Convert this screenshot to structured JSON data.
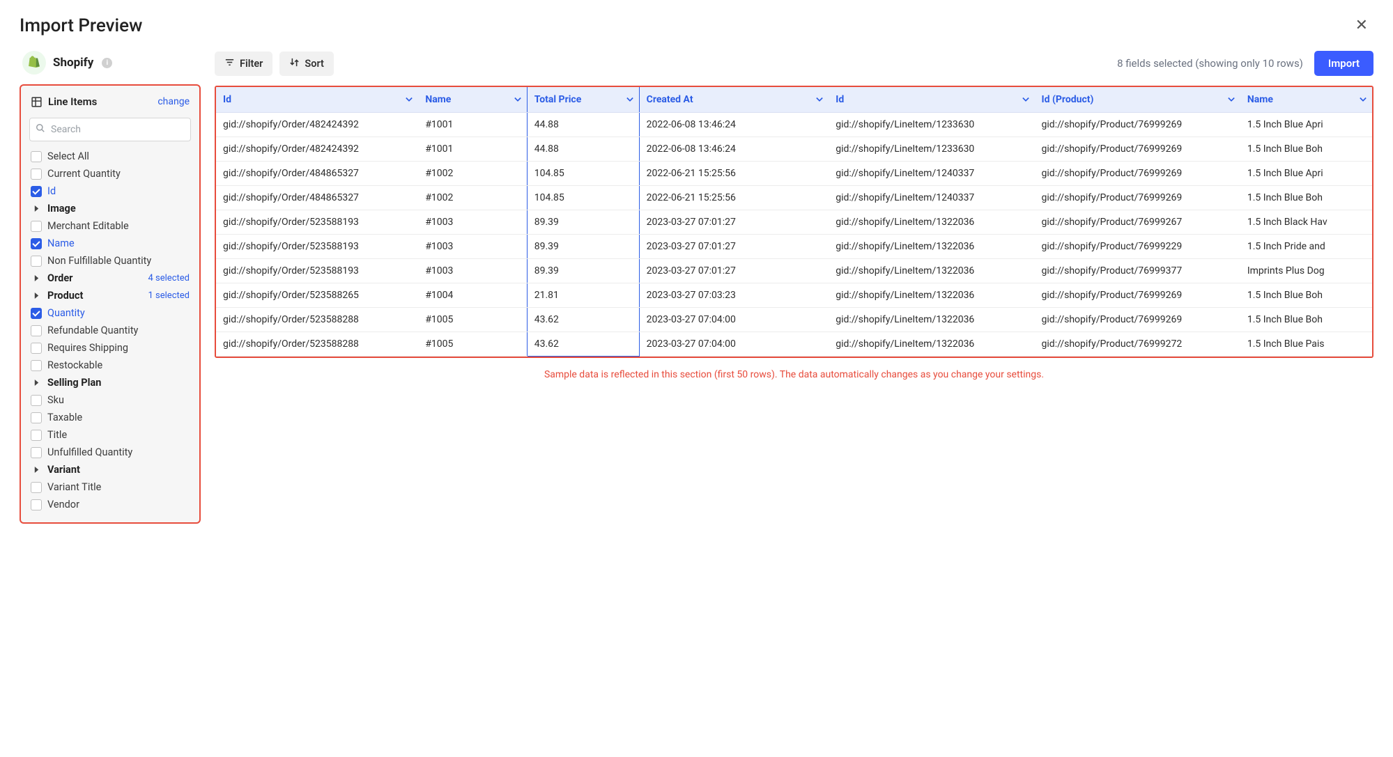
{
  "header": {
    "title": "Import Preview"
  },
  "integration": {
    "name": "Shopify"
  },
  "sidebar": {
    "section_title": "Line Items",
    "change_label": "change",
    "search_placeholder": "Search",
    "fields": [
      {
        "label": "Select All",
        "type": "check",
        "checked": false
      },
      {
        "label": "Current Quantity",
        "type": "check",
        "checked": false
      },
      {
        "label": "Id",
        "type": "check",
        "checked": true
      },
      {
        "label": "Image",
        "type": "expand",
        "bold": true
      },
      {
        "label": "Merchant Editable",
        "type": "check",
        "checked": false
      },
      {
        "label": "Name",
        "type": "check",
        "checked": true
      },
      {
        "label": "Non Fulfillable Quantity",
        "type": "check",
        "checked": false
      },
      {
        "label": "Order",
        "type": "expand",
        "bold": true,
        "badge": "4 selected"
      },
      {
        "label": "Product",
        "type": "expand",
        "bold": true,
        "badge": "1 selected"
      },
      {
        "label": "Quantity",
        "type": "check",
        "checked": true
      },
      {
        "label": "Refundable Quantity",
        "type": "check",
        "checked": false
      },
      {
        "label": "Requires Shipping",
        "type": "check",
        "checked": false
      },
      {
        "label": "Restockable",
        "type": "check",
        "checked": false
      },
      {
        "label": "Selling Plan",
        "type": "expand",
        "bold": true
      },
      {
        "label": "Sku",
        "type": "check",
        "checked": false
      },
      {
        "label": "Taxable",
        "type": "check",
        "checked": false
      },
      {
        "label": "Title",
        "type": "check",
        "checked": false
      },
      {
        "label": "Unfulfilled Quantity",
        "type": "check",
        "checked": false
      },
      {
        "label": "Variant",
        "type": "expand",
        "bold": true
      },
      {
        "label": "Variant Title",
        "type": "check",
        "checked": false
      },
      {
        "label": "Vendor",
        "type": "check",
        "checked": false
      }
    ]
  },
  "toolbar": {
    "filter_label": "Filter",
    "sort_label": "Sort",
    "status_text": "8 fields selected (showing only 10 rows)",
    "import_label": "Import"
  },
  "table": {
    "columns": [
      "Id",
      "Name",
      "Total Price",
      "Created At",
      "Id",
      "Id (Product)",
      "Name"
    ],
    "highlight_col_index": 2,
    "rows": [
      [
        "gid://shopify/Order/482424392",
        "#1001",
        "44.88",
        "2022-06-08 13:46:24",
        "gid://shopify/LineItem/1233630",
        "gid://shopify/Product/76999269",
        "1.5 Inch Blue Apri"
      ],
      [
        "gid://shopify/Order/482424392",
        "#1001",
        "44.88",
        "2022-06-08 13:46:24",
        "gid://shopify/LineItem/1233630",
        "gid://shopify/Product/76999269",
        "1.5 Inch Blue Boh"
      ],
      [
        "gid://shopify/Order/484865327",
        "#1002",
        "104.85",
        "2022-06-21 15:25:56",
        "gid://shopify/LineItem/1240337",
        "gid://shopify/Product/76999269",
        "1.5 Inch Blue Apri"
      ],
      [
        "gid://shopify/Order/484865327",
        "#1002",
        "104.85",
        "2022-06-21 15:25:56",
        "gid://shopify/LineItem/1240337",
        "gid://shopify/Product/76999269",
        "1.5 Inch Blue Boh"
      ],
      [
        "gid://shopify/Order/523588193",
        "#1003",
        "89.39",
        "2023-03-27 07:01:27",
        "gid://shopify/LineItem/1322036",
        "gid://shopify/Product/76999267",
        "1.5 Inch Black Hav"
      ],
      [
        "gid://shopify/Order/523588193",
        "#1003",
        "89.39",
        "2023-03-27 07:01:27",
        "gid://shopify/LineItem/1322036",
        "gid://shopify/Product/76999229",
        "1.5 Inch Pride and"
      ],
      [
        "gid://shopify/Order/523588193",
        "#1003",
        "89.39",
        "2023-03-27 07:01:27",
        "gid://shopify/LineItem/1322036",
        "gid://shopify/Product/76999377",
        "Imprints Plus Dog"
      ],
      [
        "gid://shopify/Order/523588265",
        "#1004",
        "21.81",
        "2023-03-27 07:03:23",
        "gid://shopify/LineItem/1322036",
        "gid://shopify/Product/76999269",
        "1.5 Inch Blue Boh"
      ],
      [
        "gid://shopify/Order/523588288",
        "#1005",
        "43.62",
        "2023-03-27 07:04:00",
        "gid://shopify/LineItem/1322036",
        "gid://shopify/Product/76999269",
        "1.5 Inch Blue Boh"
      ],
      [
        "gid://shopify/Order/523588288",
        "#1005",
        "43.62",
        "2023-03-27 07:04:00",
        "gid://shopify/LineItem/1322036",
        "gid://shopify/Product/76999272",
        "1.5 Inch Blue Pais"
      ]
    ]
  },
  "sample_note": "Sample data is reflected in this section (first 50 rows). The data automatically changes as you change your settings."
}
